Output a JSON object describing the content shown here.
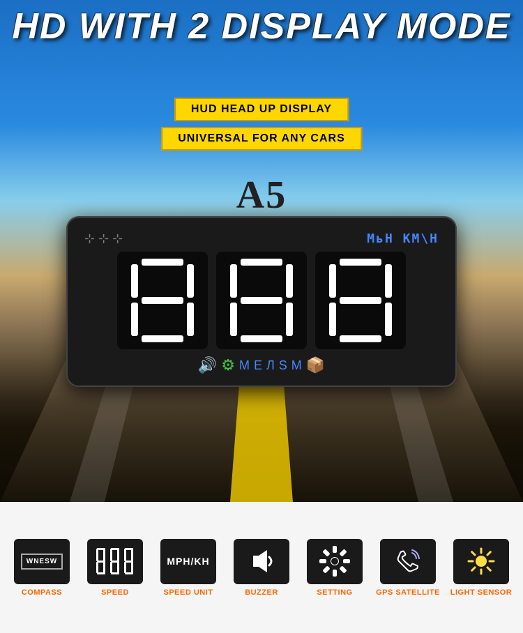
{
  "page": {
    "title": "HD With 2 Display Mode",
    "title_display": "HD WITH 2 DISPLAY MODE",
    "badge1": "HUD HEAD UP DISPLAY",
    "badge2": "UNIVERSAL FOR ANY CARS",
    "model": "A5",
    "unit": "МьН КМ\\Н",
    "device_icons": "🔊 ⚙ М Е Л Ѕ М 📦",
    "accent_color": "#FFD700",
    "hud_color": "#4488ff"
  },
  "features": [
    {
      "id": "compass",
      "label": "COMPASS",
      "icon_type": "compass",
      "icon_text": "WNESW"
    },
    {
      "id": "speed",
      "label": "SPEED",
      "icon_type": "speed_digits",
      "icon_text": "888"
    },
    {
      "id": "speed_unit",
      "label": "SPEED UNIT",
      "icon_type": "text",
      "icon_text": "MPH/KH"
    },
    {
      "id": "buzzer",
      "label": "BUZZER",
      "icon_type": "buzzer",
      "icon_text": "▶"
    },
    {
      "id": "setting",
      "label": "SETTING",
      "icon_type": "gear",
      "icon_text": "⚙"
    },
    {
      "id": "gps_satellite",
      "label": "GPS SATELLITE",
      "icon_type": "gps",
      "icon_text": "📡"
    },
    {
      "id": "light_sensor",
      "label": "LIGHT SENSOR",
      "icon_type": "sun",
      "icon_text": "☀"
    }
  ]
}
